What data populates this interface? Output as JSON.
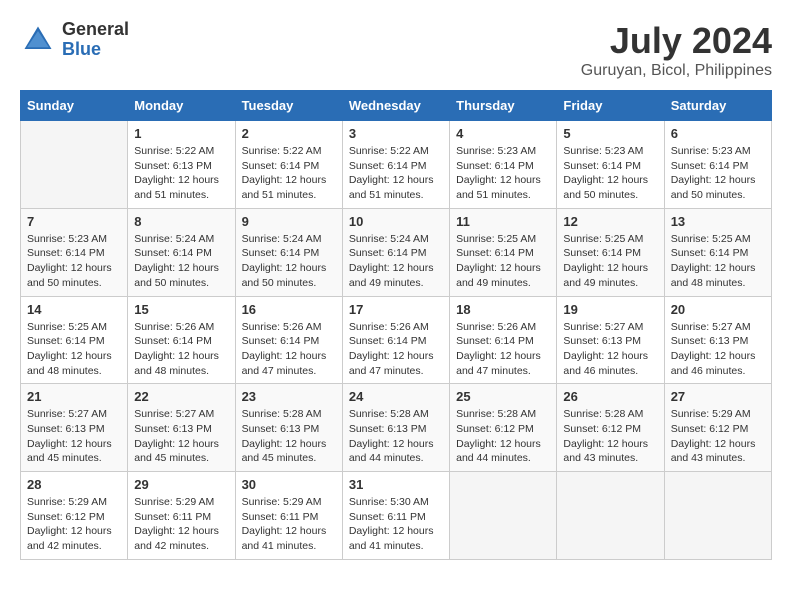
{
  "header": {
    "logo_general": "General",
    "logo_blue": "Blue",
    "title": "July 2024",
    "location": "Guruyan, Bicol, Philippines"
  },
  "columns": [
    "Sunday",
    "Monday",
    "Tuesday",
    "Wednesday",
    "Thursday",
    "Friday",
    "Saturday"
  ],
  "weeks": [
    [
      {
        "day": "",
        "sunrise": "",
        "sunset": "",
        "daylight": ""
      },
      {
        "day": "1",
        "sunrise": "Sunrise: 5:22 AM",
        "sunset": "Sunset: 6:13 PM",
        "daylight": "Daylight: 12 hours and 51 minutes."
      },
      {
        "day": "2",
        "sunrise": "Sunrise: 5:22 AM",
        "sunset": "Sunset: 6:14 PM",
        "daylight": "Daylight: 12 hours and 51 minutes."
      },
      {
        "day": "3",
        "sunrise": "Sunrise: 5:22 AM",
        "sunset": "Sunset: 6:14 PM",
        "daylight": "Daylight: 12 hours and 51 minutes."
      },
      {
        "day": "4",
        "sunrise": "Sunrise: 5:23 AM",
        "sunset": "Sunset: 6:14 PM",
        "daylight": "Daylight: 12 hours and 51 minutes."
      },
      {
        "day": "5",
        "sunrise": "Sunrise: 5:23 AM",
        "sunset": "Sunset: 6:14 PM",
        "daylight": "Daylight: 12 hours and 50 minutes."
      },
      {
        "day": "6",
        "sunrise": "Sunrise: 5:23 AM",
        "sunset": "Sunset: 6:14 PM",
        "daylight": "Daylight: 12 hours and 50 minutes."
      }
    ],
    [
      {
        "day": "7",
        "sunrise": "Sunrise: 5:23 AM",
        "sunset": "Sunset: 6:14 PM",
        "daylight": "Daylight: 12 hours and 50 minutes."
      },
      {
        "day": "8",
        "sunrise": "Sunrise: 5:24 AM",
        "sunset": "Sunset: 6:14 PM",
        "daylight": "Daylight: 12 hours and 50 minutes."
      },
      {
        "day": "9",
        "sunrise": "Sunrise: 5:24 AM",
        "sunset": "Sunset: 6:14 PM",
        "daylight": "Daylight: 12 hours and 50 minutes."
      },
      {
        "day": "10",
        "sunrise": "Sunrise: 5:24 AM",
        "sunset": "Sunset: 6:14 PM",
        "daylight": "Daylight: 12 hours and 49 minutes."
      },
      {
        "day": "11",
        "sunrise": "Sunrise: 5:25 AM",
        "sunset": "Sunset: 6:14 PM",
        "daylight": "Daylight: 12 hours and 49 minutes."
      },
      {
        "day": "12",
        "sunrise": "Sunrise: 5:25 AM",
        "sunset": "Sunset: 6:14 PM",
        "daylight": "Daylight: 12 hours and 49 minutes."
      },
      {
        "day": "13",
        "sunrise": "Sunrise: 5:25 AM",
        "sunset": "Sunset: 6:14 PM",
        "daylight": "Daylight: 12 hours and 48 minutes."
      }
    ],
    [
      {
        "day": "14",
        "sunrise": "Sunrise: 5:25 AM",
        "sunset": "Sunset: 6:14 PM",
        "daylight": "Daylight: 12 hours and 48 minutes."
      },
      {
        "day": "15",
        "sunrise": "Sunrise: 5:26 AM",
        "sunset": "Sunset: 6:14 PM",
        "daylight": "Daylight: 12 hours and 48 minutes."
      },
      {
        "day": "16",
        "sunrise": "Sunrise: 5:26 AM",
        "sunset": "Sunset: 6:14 PM",
        "daylight": "Daylight: 12 hours and 47 minutes."
      },
      {
        "day": "17",
        "sunrise": "Sunrise: 5:26 AM",
        "sunset": "Sunset: 6:14 PM",
        "daylight": "Daylight: 12 hours and 47 minutes."
      },
      {
        "day": "18",
        "sunrise": "Sunrise: 5:26 AM",
        "sunset": "Sunset: 6:14 PM",
        "daylight": "Daylight: 12 hours and 47 minutes."
      },
      {
        "day": "19",
        "sunrise": "Sunrise: 5:27 AM",
        "sunset": "Sunset: 6:13 PM",
        "daylight": "Daylight: 12 hours and 46 minutes."
      },
      {
        "day": "20",
        "sunrise": "Sunrise: 5:27 AM",
        "sunset": "Sunset: 6:13 PM",
        "daylight": "Daylight: 12 hours and 46 minutes."
      }
    ],
    [
      {
        "day": "21",
        "sunrise": "Sunrise: 5:27 AM",
        "sunset": "Sunset: 6:13 PM",
        "daylight": "Daylight: 12 hours and 45 minutes."
      },
      {
        "day": "22",
        "sunrise": "Sunrise: 5:27 AM",
        "sunset": "Sunset: 6:13 PM",
        "daylight": "Daylight: 12 hours and 45 minutes."
      },
      {
        "day": "23",
        "sunrise": "Sunrise: 5:28 AM",
        "sunset": "Sunset: 6:13 PM",
        "daylight": "Daylight: 12 hours and 45 minutes."
      },
      {
        "day": "24",
        "sunrise": "Sunrise: 5:28 AM",
        "sunset": "Sunset: 6:13 PM",
        "daylight": "Daylight: 12 hours and 44 minutes."
      },
      {
        "day": "25",
        "sunrise": "Sunrise: 5:28 AM",
        "sunset": "Sunset: 6:12 PM",
        "daylight": "Daylight: 12 hours and 44 minutes."
      },
      {
        "day": "26",
        "sunrise": "Sunrise: 5:28 AM",
        "sunset": "Sunset: 6:12 PM",
        "daylight": "Daylight: 12 hours and 43 minutes."
      },
      {
        "day": "27",
        "sunrise": "Sunrise: 5:29 AM",
        "sunset": "Sunset: 6:12 PM",
        "daylight": "Daylight: 12 hours and 43 minutes."
      }
    ],
    [
      {
        "day": "28",
        "sunrise": "Sunrise: 5:29 AM",
        "sunset": "Sunset: 6:12 PM",
        "daylight": "Daylight: 12 hours and 42 minutes."
      },
      {
        "day": "29",
        "sunrise": "Sunrise: 5:29 AM",
        "sunset": "Sunset: 6:11 PM",
        "daylight": "Daylight: 12 hours and 42 minutes."
      },
      {
        "day": "30",
        "sunrise": "Sunrise: 5:29 AM",
        "sunset": "Sunset: 6:11 PM",
        "daylight": "Daylight: 12 hours and 41 minutes."
      },
      {
        "day": "31",
        "sunrise": "Sunrise: 5:30 AM",
        "sunset": "Sunset: 6:11 PM",
        "daylight": "Daylight: 12 hours and 41 minutes."
      },
      {
        "day": "",
        "sunrise": "",
        "sunset": "",
        "daylight": ""
      },
      {
        "day": "",
        "sunrise": "",
        "sunset": "",
        "daylight": ""
      },
      {
        "day": "",
        "sunrise": "",
        "sunset": "",
        "daylight": ""
      }
    ]
  ]
}
